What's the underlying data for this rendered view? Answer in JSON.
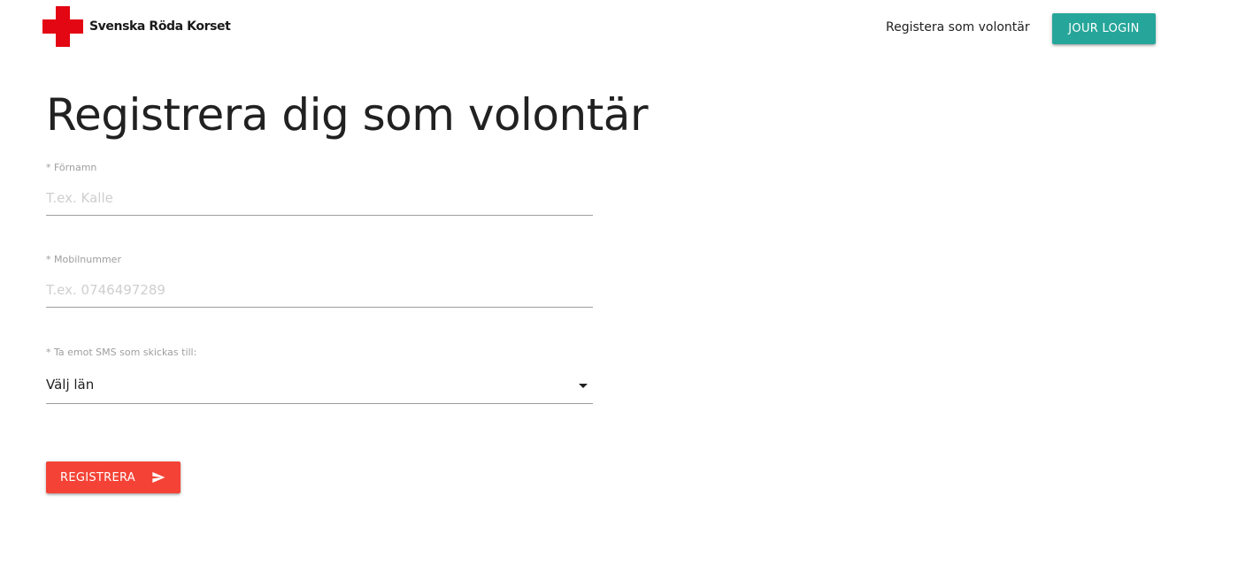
{
  "header": {
    "brand_name": "Svenska Röda Korset",
    "brand_color": "#e30613",
    "logo_icon": "red-cross-icon",
    "nav_link_label": "Registera som volontär",
    "login_button_label": "JOUR LOGIN",
    "login_button_color": "#26a69a"
  },
  "main": {
    "title": "Registrera dig som volontär",
    "form": {
      "first_name": {
        "label": "* Förnamn",
        "placeholder": "T.ex. Kalle",
        "value": ""
      },
      "mobile": {
        "label": "* Mobilnummer",
        "placeholder": "T.ex. 0746497289",
        "value": ""
      },
      "county": {
        "label": "* Ta emot SMS som skickas till:",
        "selected": "Välj län",
        "icon": "chevron-down-icon"
      },
      "submit": {
        "label": "REGISTRERA",
        "icon": "send-icon",
        "color": "#f44336"
      }
    }
  }
}
